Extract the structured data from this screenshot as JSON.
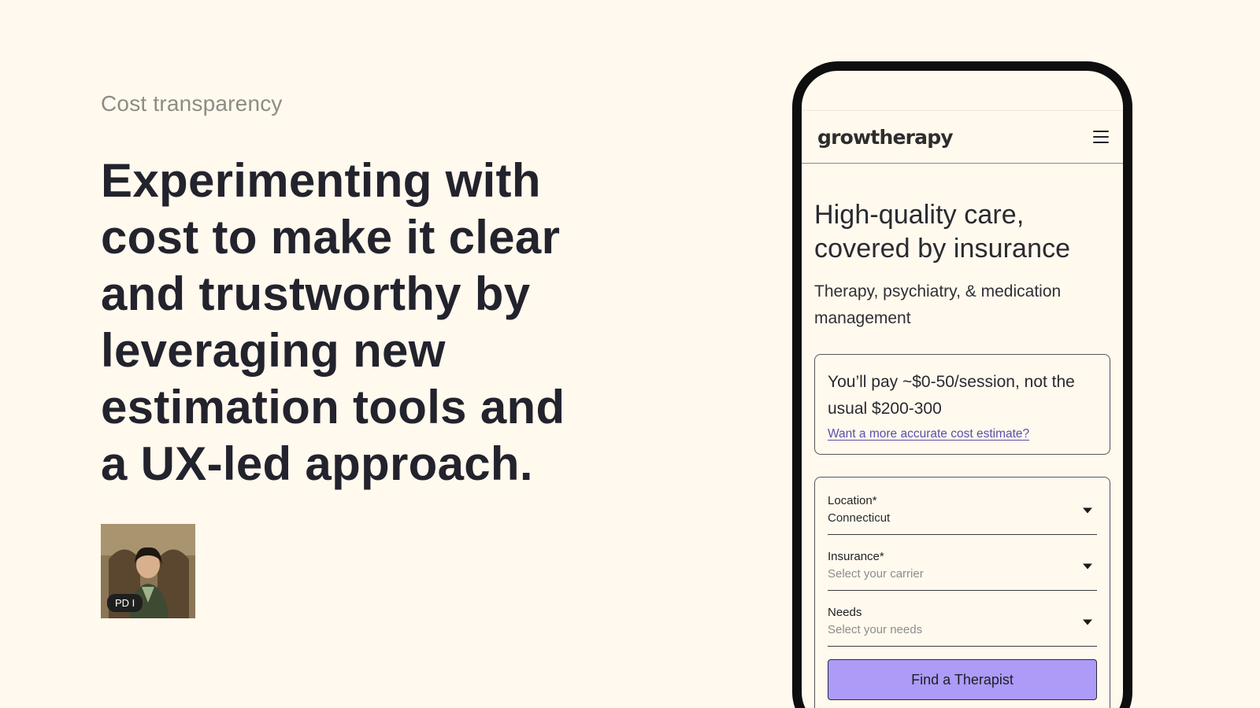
{
  "left": {
    "eyebrow": "Cost transparency",
    "headline": "Experimenting with cost to make it clear and trustworthy by leveraging new estimation tools and a UX-led approach.",
    "avatar_tag": "PD I"
  },
  "phone": {
    "logo": "growtherapy",
    "hero_title": "High-quality care, covered by insurance",
    "hero_subtitle": "Therapy, psychiatry, & medication management",
    "cost_card": {
      "text": "You’ll pay ~$0-50/session, not the usual $200-300",
      "link": "Want a more accurate cost estimate?"
    },
    "form": {
      "fields": [
        {
          "label": "Location*",
          "value": "Connecticut",
          "is_placeholder": false
        },
        {
          "label": "Insurance*",
          "value": "Select your carrier",
          "is_placeholder": true
        },
        {
          "label": "Needs",
          "value": "Select your needs",
          "is_placeholder": true
        }
      ],
      "submit_label": "Find a Therapist"
    }
  },
  "colors": {
    "background": "#fff9ee",
    "button": "#ad9bf7",
    "link": "#5b4fa6",
    "phone_frame": "#0e0e0e"
  },
  "icons": {
    "menu": "hamburger-menu-icon",
    "dropdown": "caret-down-icon"
  }
}
